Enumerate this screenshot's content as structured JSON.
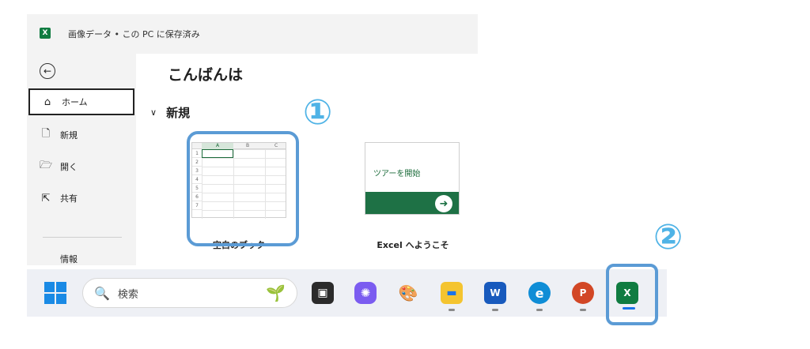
{
  "window": {
    "title": "画像データ • この PC に保存済み",
    "app_badge": "X"
  },
  "sidebar": {
    "back": "←",
    "items": [
      {
        "label": "ホーム",
        "icon": "home-icon",
        "glyph": "⌂",
        "active": true
      },
      {
        "label": "新規",
        "icon": "new-file-icon",
        "glyph": "🗋",
        "active": false
      },
      {
        "label": "開く",
        "icon": "folder-open-icon",
        "glyph": "🗁",
        "active": false
      },
      {
        "label": "共有",
        "icon": "share-icon",
        "glyph": "⇱",
        "active": false
      }
    ],
    "info": "情報"
  },
  "main": {
    "greeting": "こんばんは",
    "section_chevron": "∨",
    "section_title": "新規",
    "blank": {
      "label": "空白のブック",
      "columns": [
        "A",
        "B",
        "C"
      ],
      "rows": [
        "1",
        "2",
        "3",
        "4",
        "5",
        "6",
        "7"
      ]
    },
    "tour": {
      "text": "ツアーを開始",
      "arrow": "➜",
      "label": "Excel へようこそ"
    }
  },
  "callouts": {
    "one": "①",
    "two": "②"
  },
  "taskbar": {
    "search_glyph": "🔍",
    "search_placeholder": "検索",
    "plant_glyph": "🌱",
    "apps": [
      {
        "name": "task-view",
        "glyph": "▣"
      },
      {
        "name": "copilot",
        "glyph": "✺"
      },
      {
        "name": "paint",
        "glyph": "🎨"
      },
      {
        "name": "file-explorer",
        "glyph": "▬"
      },
      {
        "name": "word",
        "glyph": "W"
      },
      {
        "name": "edge",
        "glyph": "e"
      },
      {
        "name": "powerpoint",
        "glyph": "P"
      },
      {
        "name": "excel",
        "glyph": "X"
      }
    ]
  },
  "colors": {
    "accent_blue": "#5b9bd5",
    "callout_number": "#4fb3e6",
    "excel_green": "#1e7145"
  }
}
